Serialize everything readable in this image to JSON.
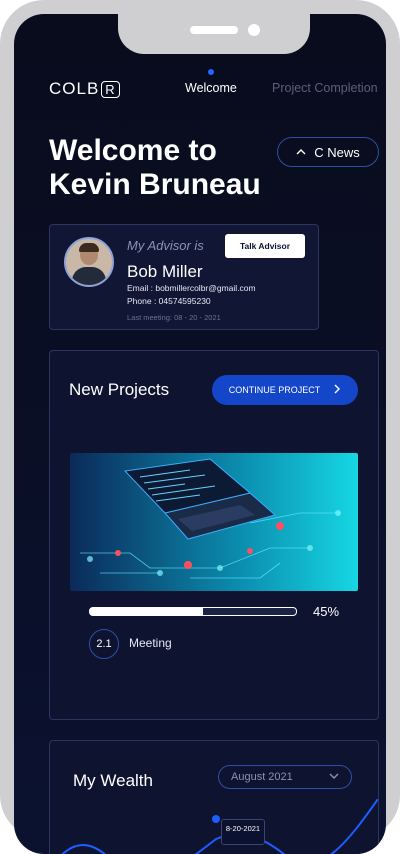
{
  "app": {
    "logo_text": "COLB",
    "logo_mark": "R"
  },
  "nav": {
    "active": "Welcome",
    "inactive": "Project Completion"
  },
  "hero": {
    "line1": "Welcome to",
    "line2": "Kevin Bruneau"
  },
  "news_button": {
    "label": "C News",
    "icon": "chevron-up-icon"
  },
  "advisor": {
    "label": "My Advisor is",
    "name": "Bob Miller",
    "email": "Email : bobmillercolbr@gmail.com",
    "phone": "Phone : 04574595230",
    "last_meeting": "Last meeting: 08 - 20 - 2021",
    "talk_button": "Talk Advisor"
  },
  "projects": {
    "title": "New Projects",
    "continue_button": "CONTINUE PROJECT",
    "progress": 0.45,
    "progress_text": "45%",
    "step_number": "2.1",
    "step_label": "Meeting"
  },
  "wealth": {
    "title": "My Wealth",
    "month": "August 2021",
    "tooltip_date": "8-20-2021"
  },
  "colors": {
    "accent": "#1346c9",
    "background": "#0a0f27",
    "card_border": "#2b3560"
  }
}
